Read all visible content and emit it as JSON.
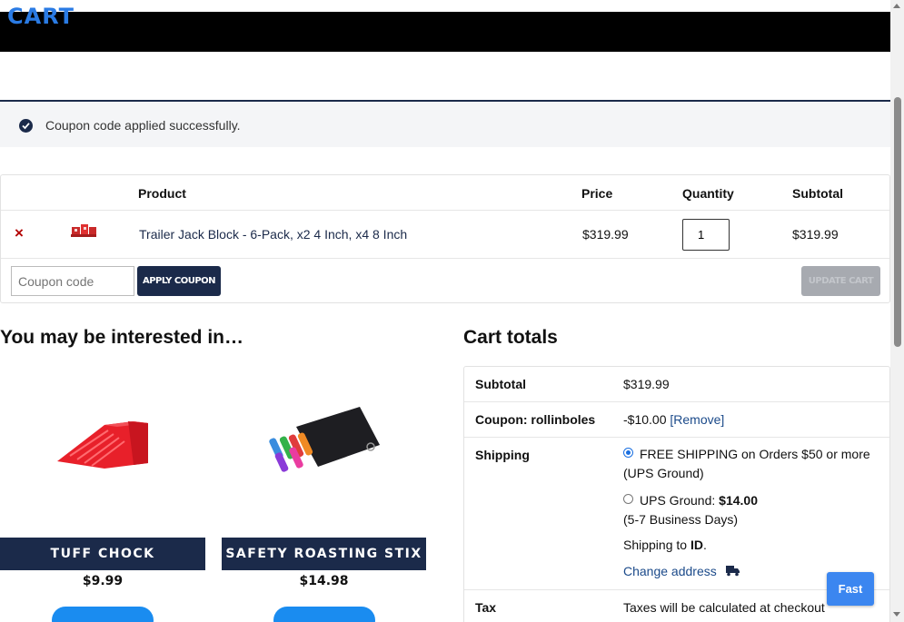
{
  "header": {
    "title": "CART"
  },
  "notice": {
    "message": "Coupon code applied successfully."
  },
  "cart_table": {
    "headers": {
      "product": "Product",
      "price": "Price",
      "quantity": "Quantity",
      "subtotal": "Subtotal"
    },
    "items": [
      {
        "remove": "×",
        "name": "Trailer Jack Block - 6-Pack, x2 4 Inch, x4 8 Inch",
        "price": "$319.99",
        "quantity": "1",
        "subtotal": "$319.99"
      }
    ],
    "coupon_placeholder": "Coupon code",
    "apply_coupon_label": "APPLY COUPON",
    "update_cart_label": "UPDATE CART"
  },
  "interested": {
    "heading": "You may be interested in…",
    "products": [
      {
        "name": "TUFF CHOCK",
        "price": "$9.99"
      },
      {
        "name": "SAFETY ROASTING STIX",
        "price": "$14.98"
      }
    ]
  },
  "totals": {
    "heading": "Cart totals",
    "subtotal_label": "Subtotal",
    "subtotal_value": "$319.99",
    "coupon_label": "Coupon: rollinboles",
    "coupon_value": "-$10.00",
    "coupon_remove": "[Remove]",
    "shipping_label": "Shipping",
    "shipping_options": [
      {
        "line1": "FREE SHIPPING on Orders $50 or more",
        "line2": "(UPS Ground)",
        "selected": true
      },
      {
        "line1": "UPS Ground: ",
        "amount": "$14.00",
        "line2": "(5-7 Business Days)",
        "selected": false
      }
    ],
    "shipping_to_prefix": "Shipping to ",
    "shipping_to_state": "ID",
    "shipping_to_suffix": ".",
    "change_address": "Change address",
    "tax_label": "Tax",
    "tax_value": "Taxes will be calculated at checkout"
  },
  "fast_button": {
    "label": "Fast"
  },
  "colors": {
    "navy": "#1b2a4a",
    "accent_blue": "#1a8cf0",
    "remove_red": "#b30000"
  }
}
